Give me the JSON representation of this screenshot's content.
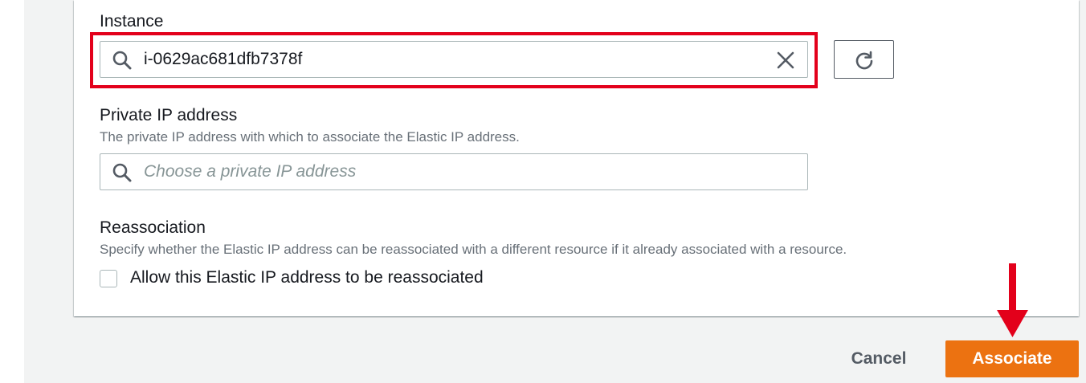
{
  "instance": {
    "label": "Instance",
    "value": "i-0629ac681dfb7378f"
  },
  "private_ip": {
    "label": "Private IP address",
    "description": "The private IP address with which to associate the Elastic IP address.",
    "placeholder": "Choose a private IP address"
  },
  "reassociation": {
    "label": "Reassociation",
    "description": "Specify whether the Elastic IP address can be reassociated with a different resource if it already associated with a resource.",
    "checkbox_label": "Allow this Elastic IP address to be reassociated",
    "checked": false
  },
  "footer": {
    "cancel_label": "Cancel",
    "associate_label": "Associate"
  },
  "colors": {
    "primary_button": "#ec7211",
    "annotation_red": "#e3001b"
  },
  "icons": [
    "search-icon",
    "clear-icon",
    "refresh-icon",
    "arrow-down-icon"
  ]
}
